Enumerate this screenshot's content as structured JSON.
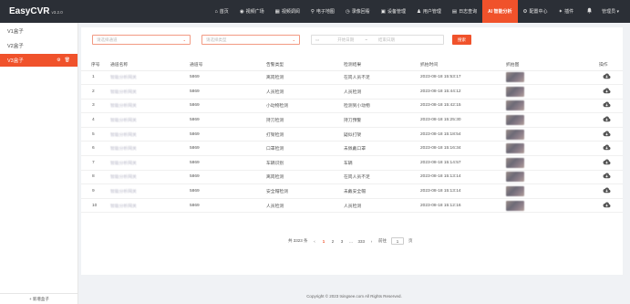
{
  "app": {
    "name": "EasyCVR",
    "version": "v3.2.0"
  },
  "nav": [
    {
      "label": "首页",
      "icon": "home-icon",
      "glyph": "⌂",
      "active": false
    },
    {
      "label": "视频广场",
      "icon": "video-square-icon",
      "glyph": "◉",
      "active": false
    },
    {
      "label": "视频调阅",
      "icon": "video-playback-icon",
      "glyph": "▦",
      "active": false
    },
    {
      "label": "电子地图",
      "icon": "map-pin-icon",
      "glyph": "⚲",
      "active": false
    },
    {
      "label": "录像回看",
      "icon": "recording-icon",
      "glyph": "◷",
      "active": false
    },
    {
      "label": "设备管理",
      "icon": "device-icon",
      "glyph": "▣",
      "active": false
    },
    {
      "label": "用户管理",
      "icon": "user-icon",
      "glyph": "♟",
      "active": false
    },
    {
      "label": "日志查询",
      "icon": "log-icon",
      "glyph": "▤",
      "active": false
    },
    {
      "label": "AI 智能分析",
      "icon": "ai-icon",
      "glyph": "",
      "active": true
    },
    {
      "label": "配置中心",
      "icon": "gear-icon",
      "glyph": "⚙",
      "active": false
    },
    {
      "label": "插件",
      "icon": "plugin-icon",
      "glyph": "✦",
      "active": false
    }
  ],
  "topright": {
    "bell_icon": "bell-icon",
    "user_label": "管理员 ▾"
  },
  "sidebar": {
    "items": [
      {
        "label": "V1盒子",
        "active": false
      },
      {
        "label": "V2盒子",
        "active": false
      },
      {
        "label": "V3盒子",
        "active": true
      }
    ],
    "add_label": "+ 新增盒子"
  },
  "filters": {
    "channel_placeholder": "请选择通道",
    "type_placeholder": "请选择类型",
    "start_placeholder": "开始日期",
    "end_placeholder": "结束日期",
    "date_sep": "~",
    "search_label": "搜索"
  },
  "table": {
    "headers": [
      "序号",
      "通道名称",
      "通道号",
      "告警类型",
      "检测结果",
      "抓拍时间",
      "抓拍图",
      "操作"
    ],
    "rows": [
      {
        "idx": "1",
        "name": "智能分析网关",
        "id": "5869",
        "type": "离岗检测",
        "result": "在岗人员不足",
        "time": "2023-08-18 15:53:17"
      },
      {
        "idx": "2",
        "name": "智能分析网关",
        "id": "5869",
        "type": "人员检测",
        "result": "人员检测",
        "time": "2023-08-18 15:44:12"
      },
      {
        "idx": "3",
        "name": "智能分析网关",
        "id": "5869",
        "type": "小动物检测",
        "result": "检测到小动物",
        "time": "2023-08-18 15:42:15"
      },
      {
        "idx": "4",
        "name": "智能分析网关",
        "id": "5869",
        "type": "持刀检测",
        "result": "持刀预警",
        "time": "2023-08-18 15:25:30"
      },
      {
        "idx": "5",
        "name": "智能分析网关",
        "id": "5869",
        "type": "打架检测",
        "result": "疑似打架",
        "time": "2023-08-18 15:18:54"
      },
      {
        "idx": "6",
        "name": "智能分析网关",
        "id": "5869",
        "type": "口罩检测",
        "result": "未佩戴口罩",
        "time": "2023-08-18 15:16:34"
      },
      {
        "idx": "7",
        "name": "智能分析网关",
        "id": "5869",
        "type": "车辆识别",
        "result": "车辆",
        "time": "2023-08-18 15:14:57"
      },
      {
        "idx": "8",
        "name": "智能分析网关",
        "id": "5869",
        "type": "离岗检测",
        "result": "在岗人员不足",
        "time": "2023-08-18 15:13:14"
      },
      {
        "idx": "9",
        "name": "智能分析网关",
        "id": "5869",
        "type": "安全帽检测",
        "result": "未戴安全帽",
        "time": "2023-08-18 15:13:14"
      },
      {
        "idx": "10",
        "name": "智能分析网关",
        "id": "5869",
        "type": "人员检测",
        "result": "人员检测",
        "time": "2023-08-18 15:12:16"
      }
    ]
  },
  "pager": {
    "total": "共 3323 条",
    "prev": "‹",
    "pages": [
      "1",
      "2",
      "3",
      "...",
      "333"
    ],
    "active_page": "1",
    "next": "›",
    "goto_label": "前往",
    "goto_value": "1",
    "page_unit": "页"
  },
  "footer": {
    "copyright": "Copyright © 2023 tsingsee.com All Rights Reserved."
  }
}
